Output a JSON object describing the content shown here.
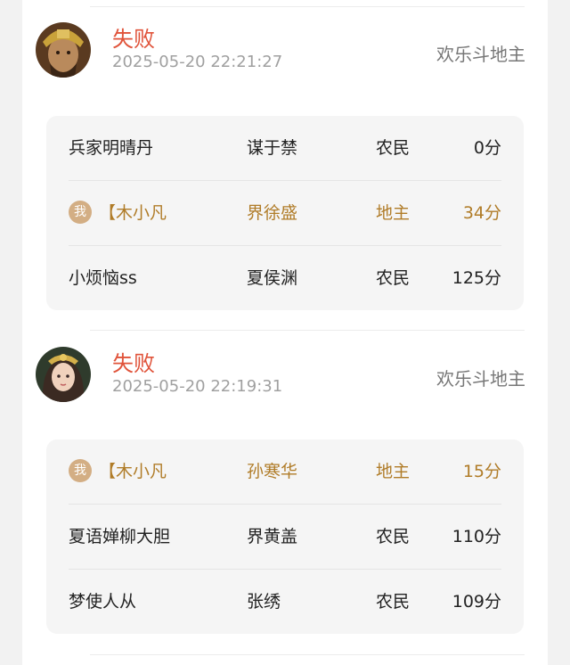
{
  "records": [
    {
      "result": "失败",
      "time": "2025-05-20 22:21:27",
      "mode": "欢乐斗地主",
      "players": [
        {
          "name": "兵家明晴丹",
          "hero": "谋于禁",
          "role": "农民",
          "score": "0分",
          "is_me": false
        },
        {
          "name": "【木小凡",
          "hero": "界徐盛",
          "role": "地主",
          "score": "34分",
          "is_me": true,
          "badge": "我"
        },
        {
          "name": "小烦恼ss",
          "hero": "夏侯渊",
          "role": "农民",
          "score": "125分",
          "is_me": false
        }
      ]
    },
    {
      "result": "失败",
      "time": "2025-05-20 22:19:31",
      "mode": "欢乐斗地主",
      "players": [
        {
          "name": "【木小凡",
          "hero": "孙寒华",
          "role": "地主",
          "score": "15分",
          "is_me": true,
          "badge": "我"
        },
        {
          "name": "夏语婵柳大胆",
          "hero": "界黄盖",
          "role": "农民",
          "score": "110分",
          "is_me": false
        },
        {
          "name": "梦使人从",
          "hero": "张绣",
          "role": "农民",
          "score": "109分",
          "is_me": false
        }
      ]
    }
  ],
  "colors": {
    "result_lose": "#e0533a",
    "me_highlight": "#b07c28",
    "me_badge_bg": "#d3ae84"
  }
}
